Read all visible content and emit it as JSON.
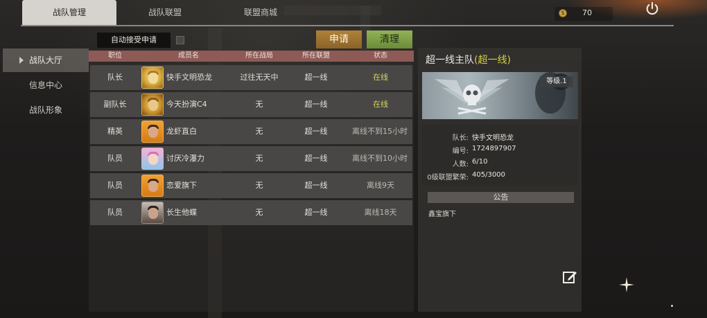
{
  "tabs": [
    {
      "label": "战队管理",
      "active": true
    },
    {
      "label": "战队联盟",
      "active": false
    },
    {
      "label": "联盟商城",
      "active": false
    }
  ],
  "currency": {
    "icon": "coin-icon",
    "value": "70"
  },
  "sidebar": {
    "items": [
      {
        "label": "战队大厅",
        "active": true
      },
      {
        "label": "信息中心",
        "active": false
      },
      {
        "label": "战队形象",
        "active": false
      }
    ]
  },
  "controls": {
    "auto_accept_label": "自动接受申请",
    "auto_accept_checked": false,
    "apply_button": "申请",
    "clean_button": "清理"
  },
  "table": {
    "headers": [
      "职位",
      "成员名",
      "所在战局",
      "所在联盟",
      "状态"
    ],
    "rows": [
      {
        "role": "队长",
        "name": "快手文明恐龙",
        "match": "过往无天中",
        "alliance": "超一线",
        "status": "在线",
        "online": true
      },
      {
        "role": "副队长",
        "name": "今天扮演C4",
        "match": "无",
        "alliance": "超一线",
        "status": "在线",
        "online": true
      },
      {
        "role": "精英",
        "name": "龙虾直白",
        "match": "无",
        "alliance": "超一线",
        "status": "离线不到15小时",
        "online": false
      },
      {
        "role": "队员",
        "name": "讨厌冷瀑力",
        "match": "无",
        "alliance": "超一线",
        "status": "离线不到10小时",
        "online": false
      },
      {
        "role": "队员",
        "name": "恋爱旗下",
        "match": "无",
        "alliance": "超一线",
        "status": "离线9天",
        "online": false
      },
      {
        "role": "队员",
        "name": "长生他蝶",
        "match": "无",
        "alliance": "超一线",
        "status": "离线18天",
        "online": false
      }
    ]
  },
  "team": {
    "title": "超一线主队",
    "alliance_tag": "(超一线)",
    "level": "等级.1",
    "info": [
      {
        "key": "队长:",
        "value": "快手文明恐龙"
      },
      {
        "key": "编号:",
        "value": "1724897907"
      },
      {
        "key": "人数:",
        "value": "6/10"
      },
      {
        "key": "0级联盟繁荣:",
        "value": "405/3000"
      }
    ],
    "notice_header": "公告",
    "notice_text": "鑫宝旗下"
  },
  "colors": {
    "header_row": "#8e5a55",
    "online": "#d2d65a",
    "apply": "#b0823a",
    "clean": "#93b257"
  }
}
